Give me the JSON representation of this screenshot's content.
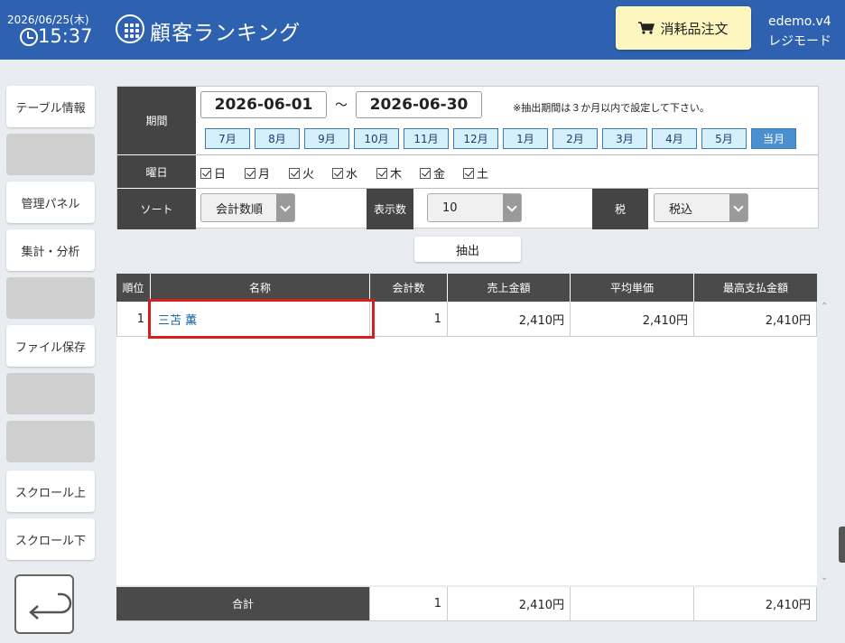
{
  "header": {
    "date": "2026/06/25(木)",
    "time": "15:37",
    "title": "顧客ランキング",
    "order_button": "消耗品注文",
    "version": "edemo.v4",
    "mode": "レジモード",
    "bg_color": "#2e62b0"
  },
  "sidebar": {
    "items": [
      {
        "label": "テーブル情報"
      },
      {
        "label": ""
      },
      {
        "label": "管理パネル"
      },
      {
        "label": "集計・分析"
      },
      {
        "label": ""
      },
      {
        "label": "ファイル保存"
      },
      {
        "label": ""
      },
      {
        "label": ""
      },
      {
        "label": "スクロール上"
      },
      {
        "label": "スクロール下"
      }
    ]
  },
  "filter": {
    "period_label": "期間",
    "date_from": "2026-06-01",
    "tilde": "～",
    "date_to": "2026-06-30",
    "note": "※抽出期間は３か月以内で設定して下さい。",
    "months": [
      "7月",
      "8月",
      "9月",
      "10月",
      "11月",
      "12月",
      "1月",
      "2月",
      "3月",
      "4月",
      "5月",
      "当月"
    ],
    "weekday_label": "曜日",
    "weekdays": [
      "日",
      "月",
      "火",
      "水",
      "木",
      "金",
      "土"
    ],
    "sort_label": "ソート",
    "sort_value": "会計数順",
    "count_label": "表示数",
    "count_value": "10",
    "tax_label": "税",
    "tax_value": "税込",
    "extract_button": "抽出"
  },
  "table": {
    "headers": [
      "順位",
      "名称",
      "会計数",
      "売上金額",
      "平均単価",
      "最高支払金額"
    ],
    "rows": [
      {
        "rank": "1",
        "name": "三苫 薫",
        "count": "1",
        "sales": "2,410円",
        "avg": "2,410円",
        "max": "2,410円"
      }
    ],
    "total": {
      "label": "合計",
      "count": "1",
      "sales": "2,410円",
      "avg": "",
      "max": "2,410円"
    }
  }
}
